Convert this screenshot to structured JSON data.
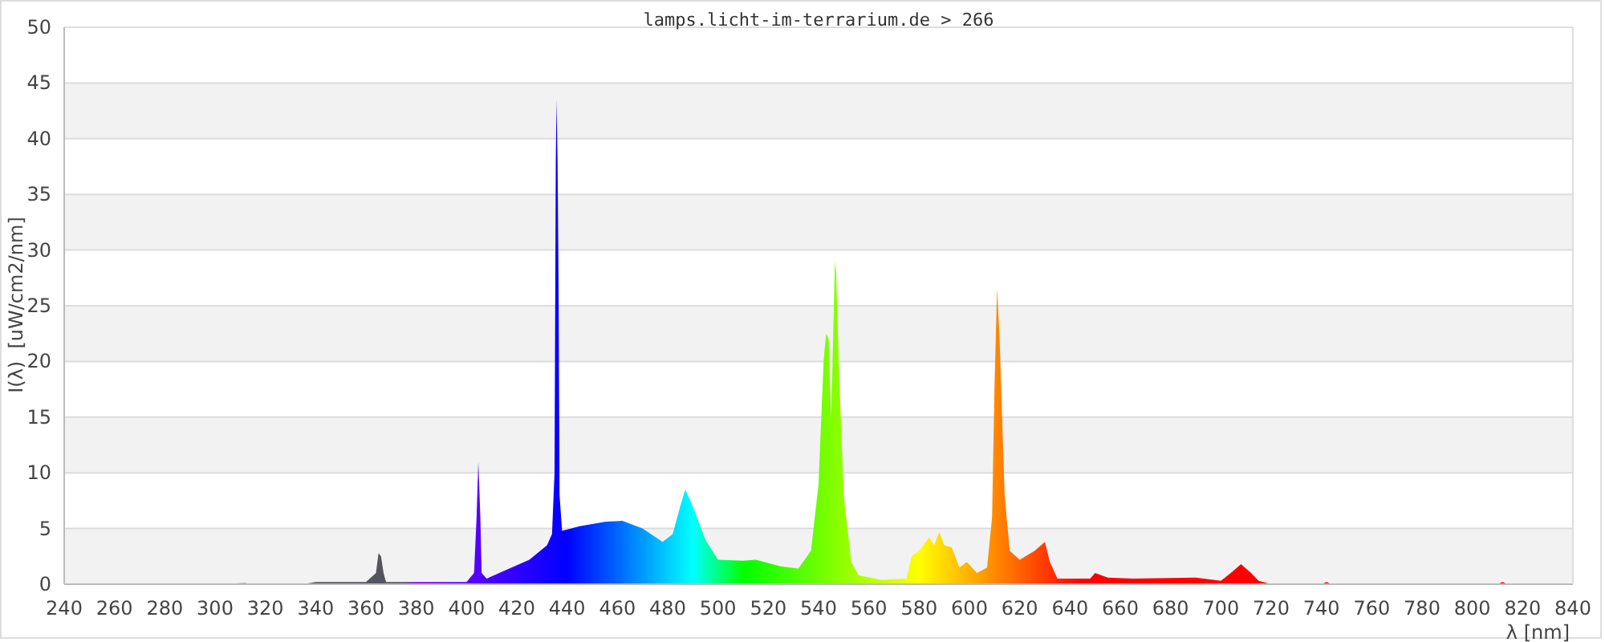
{
  "chart_data": {
    "type": "area",
    "title": "lamps.licht-im-terrarium.de > 266",
    "xlabel": "λ [nm]",
    "ylabel": "I(λ)  [uW/cm2/nm]",
    "x": [
      240,
      300,
      312,
      314,
      335,
      340,
      360,
      364,
      365,
      366,
      367,
      368,
      380,
      400,
      403,
      404,
      404.7,
      405.5,
      406,
      408,
      415,
      425,
      432,
      434,
      435,
      435.5,
      435.8,
      436.2,
      436.6,
      437,
      438,
      445,
      455,
      462,
      470,
      478,
      482,
      485,
      487,
      490,
      495,
      500,
      510,
      515,
      525,
      532,
      537,
      540,
      542,
      543,
      544,
      545,
      546,
      546.5,
      547,
      548,
      550,
      553,
      556,
      565,
      575,
      577,
      580,
      584,
      586,
      588,
      590,
      593,
      596,
      599,
      601,
      603,
      607,
      609,
      610,
      611,
      612,
      613,
      614,
      616,
      620,
      626,
      630,
      632,
      635,
      648,
      650,
      655,
      665,
      690,
      700,
      705,
      708,
      712,
      715,
      720,
      740,
      742,
      744,
      810,
      812,
      814,
      830
    ],
    "grid": true,
    "series": [
      {
        "values": [
          0,
          0,
          0.1,
          0,
          0,
          0.2,
          0.2,
          1,
          2.8,
          2.5,
          1,
          0.2,
          0.2,
          0.2,
          1,
          6,
          11,
          6,
          1,
          0.5,
          1.2,
          2.2,
          3.5,
          4.5,
          10,
          38,
          43.5,
          38,
          27,
          8,
          4.8,
          5.2,
          5.6,
          5.7,
          5,
          3.8,
          4.5,
          7,
          8.5,
          7,
          4,
          2.2,
          2.1,
          2.2,
          1.6,
          1.4,
          3,
          9,
          20,
          22.5,
          22,
          15,
          24,
          29,
          28,
          20,
          8,
          2,
          0.8,
          0.4,
          0.5,
          2.5,
          3,
          4.2,
          3.5,
          4.7,
          3.5,
          3.3,
          1.5,
          2,
          1.5,
          1,
          1.5,
          6,
          18,
          26.5,
          22,
          15,
          8,
          3,
          2.2,
          3,
          3.8,
          2,
          0.5,
          0.5,
          1,
          0.6,
          0.5,
          0.6,
          0.3,
          1.2,
          1.8,
          1,
          0.3,
          0,
          0,
          0.2,
          0,
          0,
          0.2,
          0,
          0
        ]
      }
    ],
    "xlim": [
      240,
      840
    ],
    "ylim": [
      0,
      50
    ],
    "xticks": [
      240,
      260,
      280,
      300,
      320,
      340,
      360,
      380,
      400,
      420,
      440,
      460,
      480,
      500,
      520,
      540,
      560,
      580,
      600,
      620,
      640,
      660,
      680,
      700,
      720,
      740,
      760,
      780,
      800,
      820,
      840
    ],
    "yticks": [
      0,
      5,
      10,
      15,
      20,
      25,
      30,
      35,
      40,
      45,
      50
    ]
  }
}
